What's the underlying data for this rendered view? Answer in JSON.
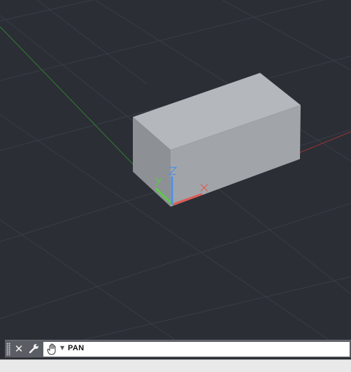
{
  "viewport": {
    "background": "#2b2e35",
    "grid_color": "#3a3d45",
    "x_axis_color": "#b03a3a",
    "y_axis_color": "#2f8f2f",
    "box_face_front": "#9fa3a8",
    "box_face_top": "#b6b9bd",
    "box_face_side": "#878b90",
    "ucs": {
      "x_label": "X",
      "y_label": "Y",
      "z_label": "Z",
      "x_color": "#e05a52",
      "y_color": "#5dc94a",
      "z_color": "#4f8fe6"
    }
  },
  "command_line": {
    "close_icon": "close-icon",
    "settings_icon": "wrench-icon",
    "command_icon": "pan-hand-icon",
    "command_text": "PAN"
  }
}
